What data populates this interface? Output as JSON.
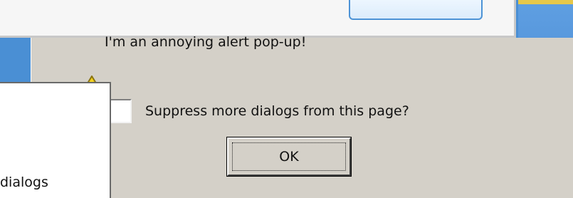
{
  "alert": {
    "message": "I'm an annoying alert pop-up!",
    "icon": "warning-icon",
    "suppress_label": "Suppress more dialogs from this page?",
    "suppress_checked": false,
    "ok_label": "OK"
  },
  "left_panel": {
    "text": "dialogs"
  },
  "colors": {
    "dialog_bg": "#d4d0c8",
    "desktop_blue": "#4a8fd4",
    "warning_yellow": "#f5d21c"
  }
}
